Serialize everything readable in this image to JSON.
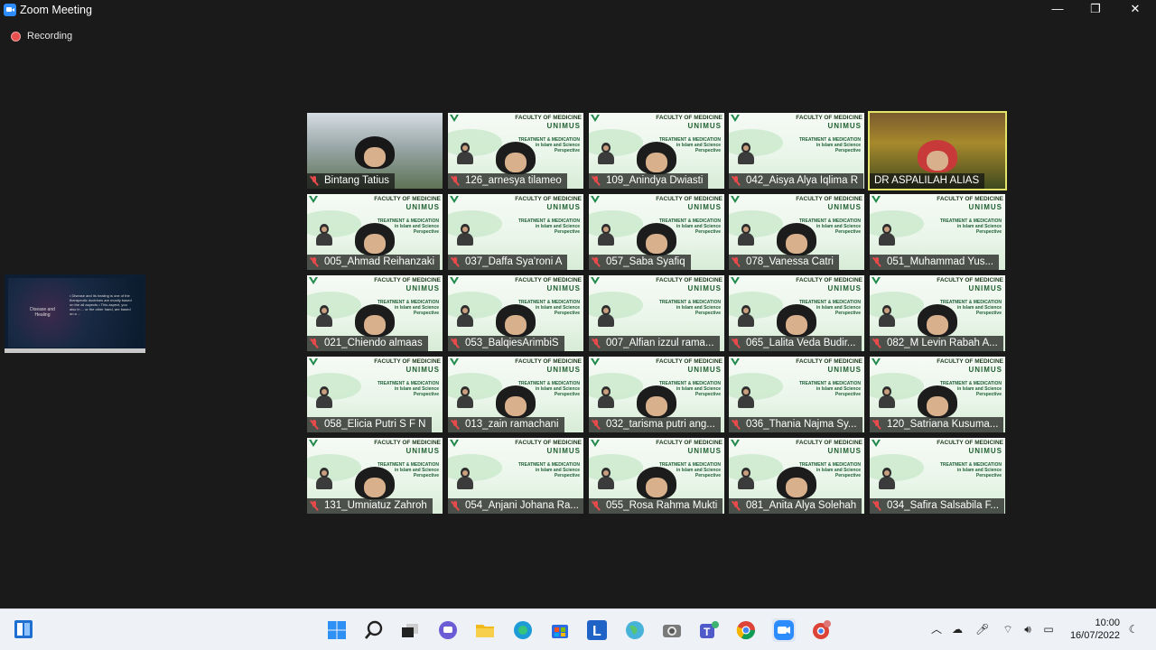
{
  "window": {
    "title": "Zoom Meeting",
    "minimize": "—",
    "maximize": "❐",
    "close": "✕"
  },
  "recording": {
    "label": "Recording"
  },
  "slide": {
    "faculty": "FACULTY OF MEDICINE",
    "university": "UNIMUS",
    "title_line1": "TREATMENT & MEDICATION",
    "title_line2": "in Islam and Science",
    "title_line3": "Perspective"
  },
  "participants": [
    {
      "name": "Bintang Tatius",
      "muted": true,
      "video": "camera"
    },
    {
      "name": "126_arnesya tilameo",
      "muted": true,
      "video": "slide"
    },
    {
      "name": "109_Anindya Dwiasti",
      "muted": true,
      "video": "slide"
    },
    {
      "name": "042_Aisya Alya Iqlima R",
      "muted": true,
      "video": "slide"
    },
    {
      "name": "DR ASPALILAH ALIAS",
      "muted": false,
      "video": "camera",
      "active": true
    },
    {
      "name": "005_Ahmad Reihanzaki",
      "muted": true,
      "video": "slide"
    },
    {
      "name": "037_Daffa Sya'roni A",
      "muted": true,
      "video": "slide"
    },
    {
      "name": "057_Saba Syafiq",
      "muted": true,
      "video": "slide"
    },
    {
      "name": "078_Vanessa Catri",
      "muted": true,
      "video": "slide"
    },
    {
      "name": "051_Muhammad Yus...",
      "muted": true,
      "video": "slide"
    },
    {
      "name": "021_Chiendo almaas",
      "muted": true,
      "video": "slide"
    },
    {
      "name": "053_BalqiesArimbiS",
      "muted": true,
      "video": "slide"
    },
    {
      "name": "007_Alfian izzul rama...",
      "muted": true,
      "video": "slide"
    },
    {
      "name": "065_Lalita Veda Budir...",
      "muted": true,
      "video": "slide"
    },
    {
      "name": "082_M Levin Rabah A...",
      "muted": true,
      "video": "slide"
    },
    {
      "name": "058_Elicia Putri S F N",
      "muted": true,
      "video": "slide"
    },
    {
      "name": "013_zain ramachani",
      "muted": true,
      "video": "slide"
    },
    {
      "name": "032_tarisma putri ang...",
      "muted": true,
      "video": "slide"
    },
    {
      "name": "036_Thania Najma Sy...",
      "muted": true,
      "video": "slide"
    },
    {
      "name": "120_Satriana Kusuma...",
      "muted": true,
      "video": "slide"
    },
    {
      "name": "131_Umniatuz Zahroh",
      "muted": true,
      "video": "slide"
    },
    {
      "name": "054_Anjani Johana Ra...",
      "muted": true,
      "video": "slide"
    },
    {
      "name": "055_Rosa Rahma Mukti",
      "muted": true,
      "video": "slide"
    },
    {
      "name": "081_Anita Alya Solehah",
      "muted": true,
      "video": "slide"
    },
    {
      "name": "034_Safira Salsabila F...",
      "muted": true,
      "video": "slide"
    }
  ],
  "share_thumbnail": {
    "left_text": "Disease and Healing",
    "right_text": "• Disease and its healing is one of the therapeutic doctrines are mostly based on the all aspects • This aspect, you also in ... or the other hand, are based on a ..."
  },
  "taskbar": {
    "time": "10:00",
    "date": "16/07/2022",
    "icons": [
      "widgets-icon",
      "start-icon",
      "search-icon",
      "task-view-icon",
      "chat-icon",
      "file-explorer-icon",
      "edge-icon",
      "store-icon",
      "l-app-icon",
      "globe-app-icon",
      "camera-app-icon",
      "teams-icon",
      "chrome-icon",
      "zoom-icon",
      "chrome-profile-icon"
    ]
  },
  "colors": {
    "background": "#1a1a1a",
    "active_speaker_border": "#e4e36a",
    "mic_muted": "#e64a4a",
    "zoom_blue": "#2d8cff"
  }
}
